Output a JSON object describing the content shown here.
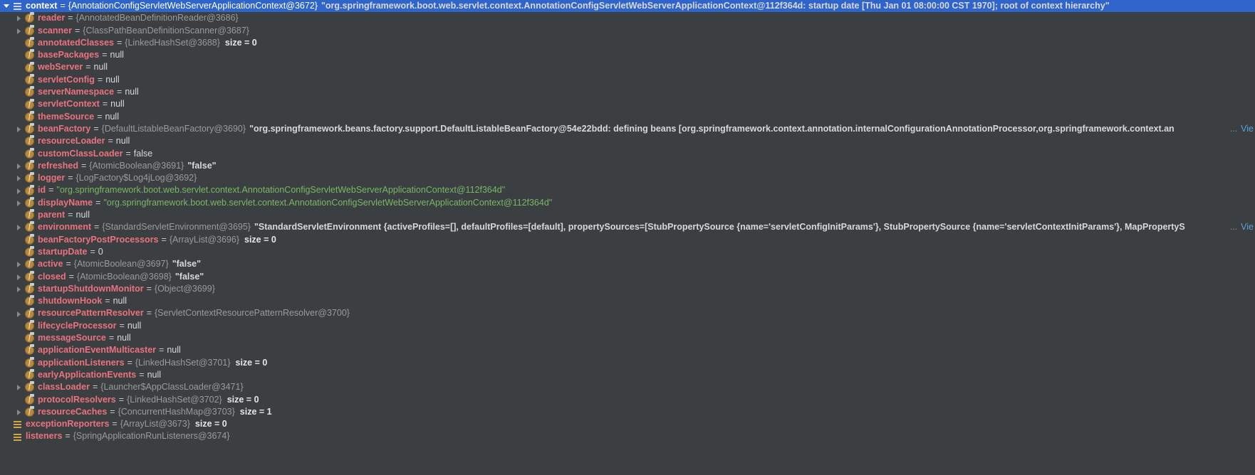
{
  "panel": {
    "title": "Debugger Variables",
    "background": "#3c3f41",
    "selection_color": "#2f65ca",
    "name_color": "#e8737e",
    "type_color": "#9a9a9a",
    "string_color": "#77b767",
    "link_color": "#5c9fdd"
  },
  "rows": [
    {
      "indent": 0,
      "toggle": "open",
      "icon": "list-icon",
      "selected": true,
      "name": "context",
      "eq": "=",
      "type": "{AnnotationConfigServletWebServerApplicationContext@3672}",
      "value": "\"org.springframework.boot.web.servlet.context.AnnotationConfigServletWebServerApplicationContext@112f364d: startup date [Thu Jan 01 08:00:00 CST 1970]; root of context hierarchy\"",
      "value_kind": "plain",
      "size": "",
      "truncated": false,
      "view_label": ""
    },
    {
      "indent": 1,
      "toggle": "closed",
      "icon": "field-icon",
      "selected": false,
      "name": "reader",
      "eq": "=",
      "type": "{AnnotatedBeanDefinitionReader@3686}",
      "value": "",
      "value_kind": "none",
      "size": "",
      "truncated": false,
      "view_label": ""
    },
    {
      "indent": 1,
      "toggle": "closed",
      "icon": "field-icon",
      "selected": false,
      "name": "scanner",
      "eq": "=",
      "type": "{ClassPathBeanDefinitionScanner@3687}",
      "value": "",
      "value_kind": "none",
      "size": "",
      "truncated": false,
      "view_label": ""
    },
    {
      "indent": 1,
      "toggle": "none",
      "icon": "field-icon",
      "selected": false,
      "name": "annotatedClasses",
      "eq": "=",
      "type": "{LinkedHashSet@3688}",
      "value": "",
      "value_kind": "none",
      "size": "size = 0",
      "truncated": false,
      "view_label": ""
    },
    {
      "indent": 1,
      "toggle": "none",
      "icon": "field-icon",
      "selected": false,
      "name": "basePackages",
      "eq": "=",
      "type": "",
      "value": "null",
      "value_kind": "null",
      "size": "",
      "truncated": false,
      "view_label": ""
    },
    {
      "indent": 1,
      "toggle": "none",
      "icon": "field-icon",
      "selected": false,
      "name": "webServer",
      "eq": "=",
      "type": "",
      "value": "null",
      "value_kind": "null",
      "size": "",
      "truncated": false,
      "view_label": ""
    },
    {
      "indent": 1,
      "toggle": "none",
      "icon": "field-icon",
      "selected": false,
      "name": "servletConfig",
      "eq": "=",
      "type": "",
      "value": "null",
      "value_kind": "null",
      "size": "",
      "truncated": false,
      "view_label": ""
    },
    {
      "indent": 1,
      "toggle": "none",
      "icon": "field-icon",
      "selected": false,
      "name": "serverNamespace",
      "eq": "=",
      "type": "",
      "value": "null",
      "value_kind": "null",
      "size": "",
      "truncated": false,
      "view_label": ""
    },
    {
      "indent": 1,
      "toggle": "none",
      "icon": "field-icon",
      "selected": false,
      "name": "servletContext",
      "eq": "=",
      "type": "",
      "value": "null",
      "value_kind": "null",
      "size": "",
      "truncated": false,
      "view_label": ""
    },
    {
      "indent": 1,
      "toggle": "none",
      "icon": "field-icon",
      "selected": false,
      "name": "themeSource",
      "eq": "=",
      "type": "",
      "value": "null",
      "value_kind": "null",
      "size": "",
      "truncated": false,
      "view_label": ""
    },
    {
      "indent": 1,
      "toggle": "closed",
      "icon": "field-icon",
      "selected": false,
      "name": "beanFactory",
      "eq": "=",
      "type": "{DefaultListableBeanFactory@3690}",
      "value": "\"org.springframework.beans.factory.support.DefaultListableBeanFactory@54e22bdd: defining beans [org.springframework.context.annotation.internalConfigurationAnnotationProcessor,org.springframework.context.an",
      "value_kind": "plain",
      "size": "",
      "truncated": true,
      "view_label": "Vie"
    },
    {
      "indent": 1,
      "toggle": "none",
      "icon": "field-icon",
      "selected": false,
      "name": "resourceLoader",
      "eq": "=",
      "type": "",
      "value": "null",
      "value_kind": "null",
      "size": "",
      "truncated": false,
      "view_label": ""
    },
    {
      "indent": 1,
      "toggle": "none",
      "icon": "field-icon",
      "selected": false,
      "name": "customClassLoader",
      "eq": "=",
      "type": "",
      "value": "false",
      "value_kind": "null",
      "size": "",
      "truncated": false,
      "view_label": ""
    },
    {
      "indent": 1,
      "toggle": "closed",
      "icon": "field-icon",
      "selected": false,
      "name": "refreshed",
      "eq": "=",
      "type": "{AtomicBoolean@3691}",
      "value": "\"false\"",
      "value_kind": "plain",
      "size": "",
      "truncated": false,
      "view_label": ""
    },
    {
      "indent": 1,
      "toggle": "closed",
      "icon": "field-icon",
      "selected": false,
      "name": "logger",
      "eq": "=",
      "type": "{LogFactory$Log4jLog@3692}",
      "value": "",
      "value_kind": "none",
      "size": "",
      "truncated": false,
      "view_label": ""
    },
    {
      "indent": 1,
      "toggle": "closed",
      "icon": "field-icon",
      "selected": false,
      "name": "id",
      "eq": "=",
      "type": "",
      "value": "\"org.springframework.boot.web.servlet.context.AnnotationConfigServletWebServerApplicationContext@112f364d\"",
      "value_kind": "string",
      "size": "",
      "truncated": false,
      "view_label": ""
    },
    {
      "indent": 1,
      "toggle": "closed",
      "icon": "field-icon",
      "selected": false,
      "name": "displayName",
      "eq": "=",
      "type": "",
      "value": "\"org.springframework.boot.web.servlet.context.AnnotationConfigServletWebServerApplicationContext@112f364d\"",
      "value_kind": "string",
      "size": "",
      "truncated": false,
      "view_label": ""
    },
    {
      "indent": 1,
      "toggle": "none",
      "icon": "field-icon",
      "selected": false,
      "name": "parent",
      "eq": "=",
      "type": "",
      "value": "null",
      "value_kind": "null",
      "size": "",
      "truncated": false,
      "view_label": ""
    },
    {
      "indent": 1,
      "toggle": "closed",
      "icon": "field-icon",
      "selected": false,
      "name": "environment",
      "eq": "=",
      "type": "{StandardServletEnvironment@3695}",
      "value": "\"StandardServletEnvironment {activeProfiles=[], defaultProfiles=[default], propertySources=[StubPropertySource {name='servletConfigInitParams'}, StubPropertySource {name='servletContextInitParams'}, MapPropertyS",
      "value_kind": "plain",
      "size": "",
      "truncated": true,
      "view_label": "Vie"
    },
    {
      "indent": 1,
      "toggle": "none",
      "icon": "field-icon",
      "selected": false,
      "name": "beanFactoryPostProcessors",
      "eq": "=",
      "type": "{ArrayList@3696}",
      "value": "",
      "value_kind": "none",
      "size": "size = 0",
      "truncated": false,
      "view_label": ""
    },
    {
      "indent": 1,
      "toggle": "none",
      "icon": "field-icon",
      "selected": false,
      "name": "startupDate",
      "eq": "=",
      "type": "",
      "value": "0",
      "value_kind": "null",
      "size": "",
      "truncated": false,
      "view_label": ""
    },
    {
      "indent": 1,
      "toggle": "closed",
      "icon": "field-icon",
      "selected": false,
      "name": "active",
      "eq": "=",
      "type": "{AtomicBoolean@3697}",
      "value": "\"false\"",
      "value_kind": "plain",
      "size": "",
      "truncated": false,
      "view_label": ""
    },
    {
      "indent": 1,
      "toggle": "closed",
      "icon": "field-icon",
      "selected": false,
      "name": "closed",
      "eq": "=",
      "type": "{AtomicBoolean@3698}",
      "value": "\"false\"",
      "value_kind": "plain",
      "size": "",
      "truncated": false,
      "view_label": ""
    },
    {
      "indent": 1,
      "toggle": "closed",
      "icon": "field-icon",
      "selected": false,
      "name": "startupShutdownMonitor",
      "eq": "=",
      "type": "{Object@3699}",
      "value": "",
      "value_kind": "none",
      "size": "",
      "truncated": false,
      "view_label": ""
    },
    {
      "indent": 1,
      "toggle": "none",
      "icon": "field-icon",
      "selected": false,
      "name": "shutdownHook",
      "eq": "=",
      "type": "",
      "value": "null",
      "value_kind": "null",
      "size": "",
      "truncated": false,
      "view_label": ""
    },
    {
      "indent": 1,
      "toggle": "closed",
      "icon": "field-icon",
      "selected": false,
      "name": "resourcePatternResolver",
      "eq": "=",
      "type": "{ServletContextResourcePatternResolver@3700}",
      "value": "",
      "value_kind": "none",
      "size": "",
      "truncated": false,
      "view_label": ""
    },
    {
      "indent": 1,
      "toggle": "none",
      "icon": "field-icon",
      "selected": false,
      "name": "lifecycleProcessor",
      "eq": "=",
      "type": "",
      "value": "null",
      "value_kind": "null",
      "size": "",
      "truncated": false,
      "view_label": ""
    },
    {
      "indent": 1,
      "toggle": "none",
      "icon": "field-icon",
      "selected": false,
      "name": "messageSource",
      "eq": "=",
      "type": "",
      "value": "null",
      "value_kind": "null",
      "size": "",
      "truncated": false,
      "view_label": ""
    },
    {
      "indent": 1,
      "toggle": "none",
      "icon": "field-icon",
      "selected": false,
      "name": "applicationEventMulticaster",
      "eq": "=",
      "type": "",
      "value": "null",
      "value_kind": "null",
      "size": "",
      "truncated": false,
      "view_label": ""
    },
    {
      "indent": 1,
      "toggle": "none",
      "icon": "field-icon",
      "selected": false,
      "name": "applicationListeners",
      "eq": "=",
      "type": "{LinkedHashSet@3701}",
      "value": "",
      "value_kind": "none",
      "size": "size = 0",
      "truncated": false,
      "view_label": ""
    },
    {
      "indent": 1,
      "toggle": "none",
      "icon": "field-icon",
      "selected": false,
      "name": "earlyApplicationEvents",
      "eq": "=",
      "type": "",
      "value": "null",
      "value_kind": "null",
      "size": "",
      "truncated": false,
      "view_label": ""
    },
    {
      "indent": 1,
      "toggle": "closed",
      "icon": "field-icon",
      "selected": false,
      "name": "classLoader",
      "eq": "=",
      "type": "{Launcher$AppClassLoader@3471}",
      "value": "",
      "value_kind": "none",
      "size": "",
      "truncated": false,
      "view_label": ""
    },
    {
      "indent": 1,
      "toggle": "none",
      "icon": "field-icon",
      "selected": false,
      "name": "protocolResolvers",
      "eq": "=",
      "type": "{LinkedHashSet@3702}",
      "value": "",
      "value_kind": "none",
      "size": "size = 0",
      "truncated": false,
      "view_label": ""
    },
    {
      "indent": 1,
      "toggle": "closed",
      "icon": "field-icon",
      "selected": false,
      "name": "resourceCaches",
      "eq": "=",
      "type": "{ConcurrentHashMap@3703}",
      "value": "",
      "value_kind": "none",
      "size": "size = 1",
      "truncated": false,
      "view_label": ""
    },
    {
      "indent": 0,
      "toggle": "none",
      "icon": "list-icon-yellow",
      "selected": false,
      "name": "exceptionReporters",
      "eq": "=",
      "type": "{ArrayList@3673}",
      "value": "",
      "value_kind": "none",
      "size": "size = 0",
      "truncated": false,
      "view_label": ""
    },
    {
      "indent": 0,
      "toggle": "none",
      "icon": "list-icon-yellow",
      "selected": false,
      "name": "listeners",
      "eq": "=",
      "type": "{SpringApplicationRunListeners@3674}",
      "value": "",
      "value_kind": "none",
      "size": "",
      "truncated": false,
      "view_label": ""
    }
  ]
}
